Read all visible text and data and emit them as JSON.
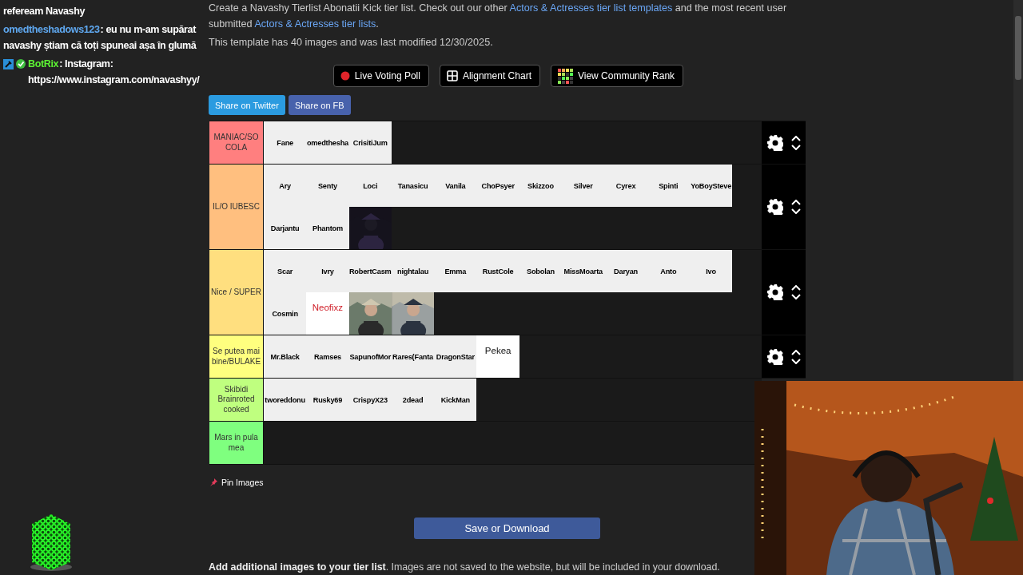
{
  "chat": [
    {
      "text": "refeream Navashy"
    },
    {
      "user": "omedtheshadows123",
      "color": "#5fa8f0",
      "badged": false,
      "text": ": eu nu m-am supărat navashy știam că toți spuneai așa în glumă"
    },
    {
      "user": "BotRix",
      "color": "#5cf233",
      "badged": true,
      "text": ": Instagram: https://www.instagram.com/navashyy/"
    }
  ],
  "intro": [
    {
      "kind": "text",
      "text": "Create a Navashy Tierlist Abonatii Kick tier list. Check out our other "
    },
    {
      "kind": "link",
      "text": "Actors & Actresses tier list templates"
    },
    {
      "kind": "text",
      "text": " and the most recent user submitted "
    },
    {
      "kind": "link",
      "text": "Actors & Actresses tier lists"
    },
    {
      "kind": "text",
      "text": "."
    }
  ],
  "meta": "This template has 40 images and was last modified 12/30/2025.",
  "tool_buttons": [
    {
      "kind": "poll",
      "label": "Live Voting Poll"
    },
    {
      "kind": "alignment",
      "label": "Alignment Chart"
    },
    {
      "kind": "rank",
      "label": "View Community Rank"
    }
  ],
  "share_buttons": [
    {
      "label": "Share on Twitter",
      "color": "#2b9be0"
    },
    {
      "label": "Share on FB",
      "color": "#4862ac"
    }
  ],
  "tiers": [
    {
      "label": "MANIAC/SOCOLA",
      "color": "#ff7f7f",
      "controls": true,
      "items": [
        {
          "kind": "name",
          "text": "Fane"
        },
        {
          "kind": "name",
          "text": "omedthesha"
        },
        {
          "kind": "name",
          "text": "CrisitiJum"
        }
      ]
    },
    {
      "label": "IL/O IUBESC",
      "color": "#ffbf7f",
      "controls": true,
      "items": [
        {
          "kind": "name",
          "text": "Ary"
        },
        {
          "kind": "name",
          "text": "Senty"
        },
        {
          "kind": "name",
          "text": "Loci"
        },
        {
          "kind": "name",
          "text": "Tanasicu"
        },
        {
          "kind": "name",
          "text": "Vanila"
        },
        {
          "kind": "name",
          "text": "ChoPsyer"
        },
        {
          "kind": "name",
          "text": "Skizzoo"
        },
        {
          "kind": "name",
          "text": "Silver"
        },
        {
          "kind": "name",
          "text": "Cyrex"
        },
        {
          "kind": "name",
          "text": "Spinti"
        },
        {
          "kind": "name",
          "text": "YoBoySteve"
        },
        {
          "kind": "name",
          "text": "Darjantu"
        },
        {
          "kind": "name",
          "text": "Phantom"
        },
        {
          "kind": "picture"
        }
      ]
    },
    {
      "label": "Nice / SUPER",
      "color": "#ffdf7f",
      "controls": true,
      "items": [
        {
          "kind": "name",
          "text": "Scar"
        },
        {
          "kind": "name",
          "text": "Ivry"
        },
        {
          "kind": "name",
          "text": "RobertCasm"
        },
        {
          "kind": "name",
          "text": "nightalau"
        },
        {
          "kind": "name",
          "text": "Emma"
        },
        {
          "kind": "name",
          "text": "RustCole"
        },
        {
          "kind": "name",
          "text": "Sobolan"
        },
        {
          "kind": "name",
          "text": "MissMoarta"
        },
        {
          "kind": "name",
          "text": "Daryan"
        },
        {
          "kind": "name",
          "text": "Anto"
        },
        {
          "kind": "name",
          "text": "Ivo"
        },
        {
          "kind": "name",
          "text": "Cosmin"
        },
        {
          "kind": "caption",
          "text": "Neofixz",
          "color": "#d0202a"
        },
        {
          "kind": "picture"
        },
        {
          "kind": "picture"
        }
      ]
    },
    {
      "label": "Se putea mai bine/BULAKE",
      "color": "#ffff7f",
      "controls": true,
      "items": [
        {
          "kind": "name",
          "text": "Mr.Black"
        },
        {
          "kind": "name",
          "text": "Ramses"
        },
        {
          "kind": "name",
          "text": "SapunofMor"
        },
        {
          "kind": "name",
          "text": "Rares(Fanta"
        },
        {
          "kind": "name",
          "text": "DragonStar"
        },
        {
          "kind": "caption",
          "text": "Pekea",
          "color": "#111111"
        }
      ]
    },
    {
      "label": "Skibidi Brainroted cooked",
      "color": "#bfff7f",
      "controls": false,
      "items": [
        {
          "kind": "name",
          "text": "tworeddonu"
        },
        {
          "kind": "name",
          "text": "Rusky69"
        },
        {
          "kind": "name",
          "text": "CrispyX23"
        },
        {
          "kind": "name",
          "text": "2dead"
        },
        {
          "kind": "name",
          "text": "KickMan"
        }
      ]
    },
    {
      "label": "Mars in pula mea",
      "color": "#7fff7f",
      "controls": false
    }
  ],
  "pin": "Pin Images",
  "save": "Save or Download",
  "footer": "**Add additional images to your tier list**. Images are not saved to the website, but will be included in your download.",
  "webcam": {
    "kind": "picture"
  }
}
